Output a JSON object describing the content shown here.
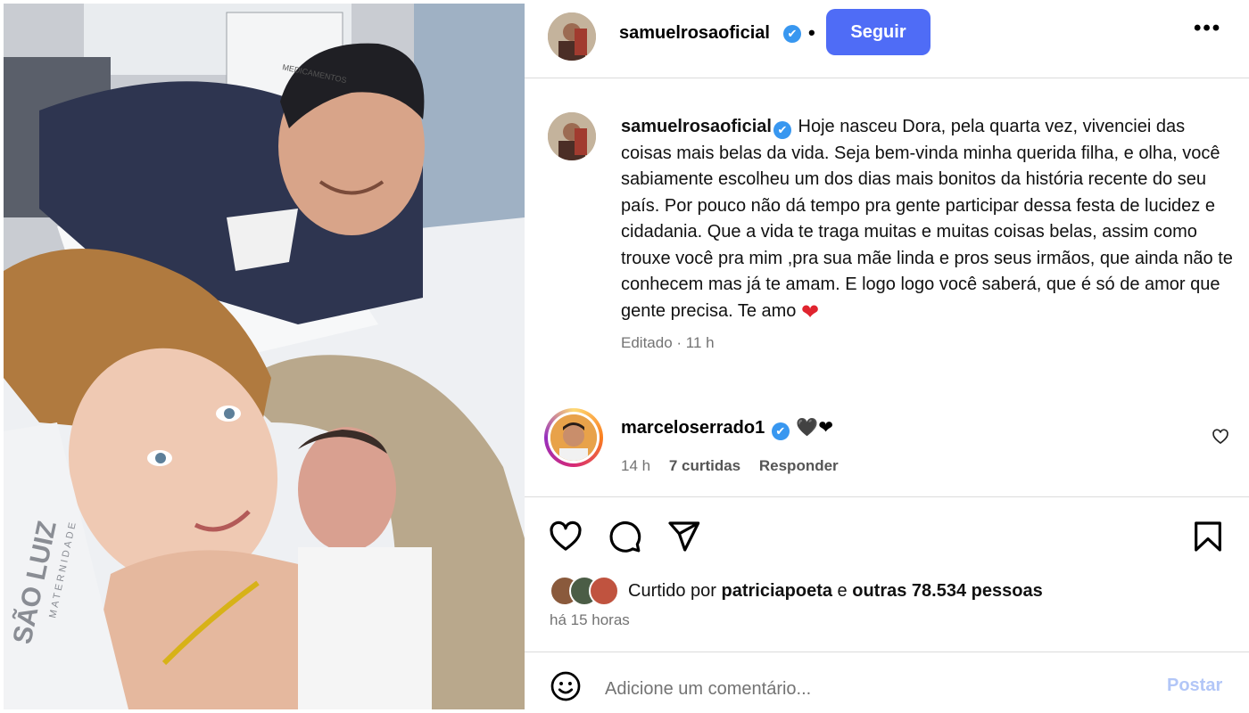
{
  "post": {
    "image_alt": "Selfie in a hospital bed: woman holding newborn, man smiling behind",
    "photo_texts": [
      "SÃO LUIZ",
      "MATERNIDADE",
      "MEDICAMENTOS"
    ]
  },
  "header": {
    "username": "samuelrosaoficial",
    "verified_mark": "✔",
    "separator": "•",
    "follow_label": "Seguir",
    "more_label": "•••"
  },
  "caption": {
    "username": "samuelrosaoficial",
    "text": "Hoje nasceu Dora, pela quarta vez, vivenciei das coisas mais belas da vida. Seja bem-vinda minha querida filha, e olha, você sabiamente escolheu um dos dias mais bonitos da história recente do seu país. Por pouco não dá tempo pra gente participar dessa festa de lucidez e cidadania. Que a vida te traga muitas e muitas coisas belas, assim como trouxe você pra mim ,pra sua mãe linda e pros seus irmãos, que ainda não te conhecem mas já te amam. E logo logo você saberá, que é só de amor que gente precisa. Te amo",
    "emoji": "❤",
    "meta": "Editado · 11 h"
  },
  "comment": {
    "username": "marceloserrado1",
    "text": "🖤❤",
    "time": "14 h",
    "likes": "7 curtidas",
    "reply_label": "Responder"
  },
  "likes": {
    "prefix": "Curtido por ",
    "user": "patriciapoeta",
    "middle": " e ",
    "others": "outras 78.534 pessoas",
    "time_ago": "há 15 horas"
  },
  "add_comment": {
    "placeholder": "Adicione um comentário...",
    "post_label": "Postar"
  },
  "colors": {
    "follow_button": "#4f6cf6",
    "verified": "#3897f0",
    "post_button_disabled": "#b2c6f7",
    "heart": "#e0242f"
  },
  "icons": [
    "like-icon",
    "comment-icon",
    "share-icon",
    "save-icon",
    "emoji-icon",
    "small-heart-icon",
    "more-icon",
    "verified-icon"
  ]
}
